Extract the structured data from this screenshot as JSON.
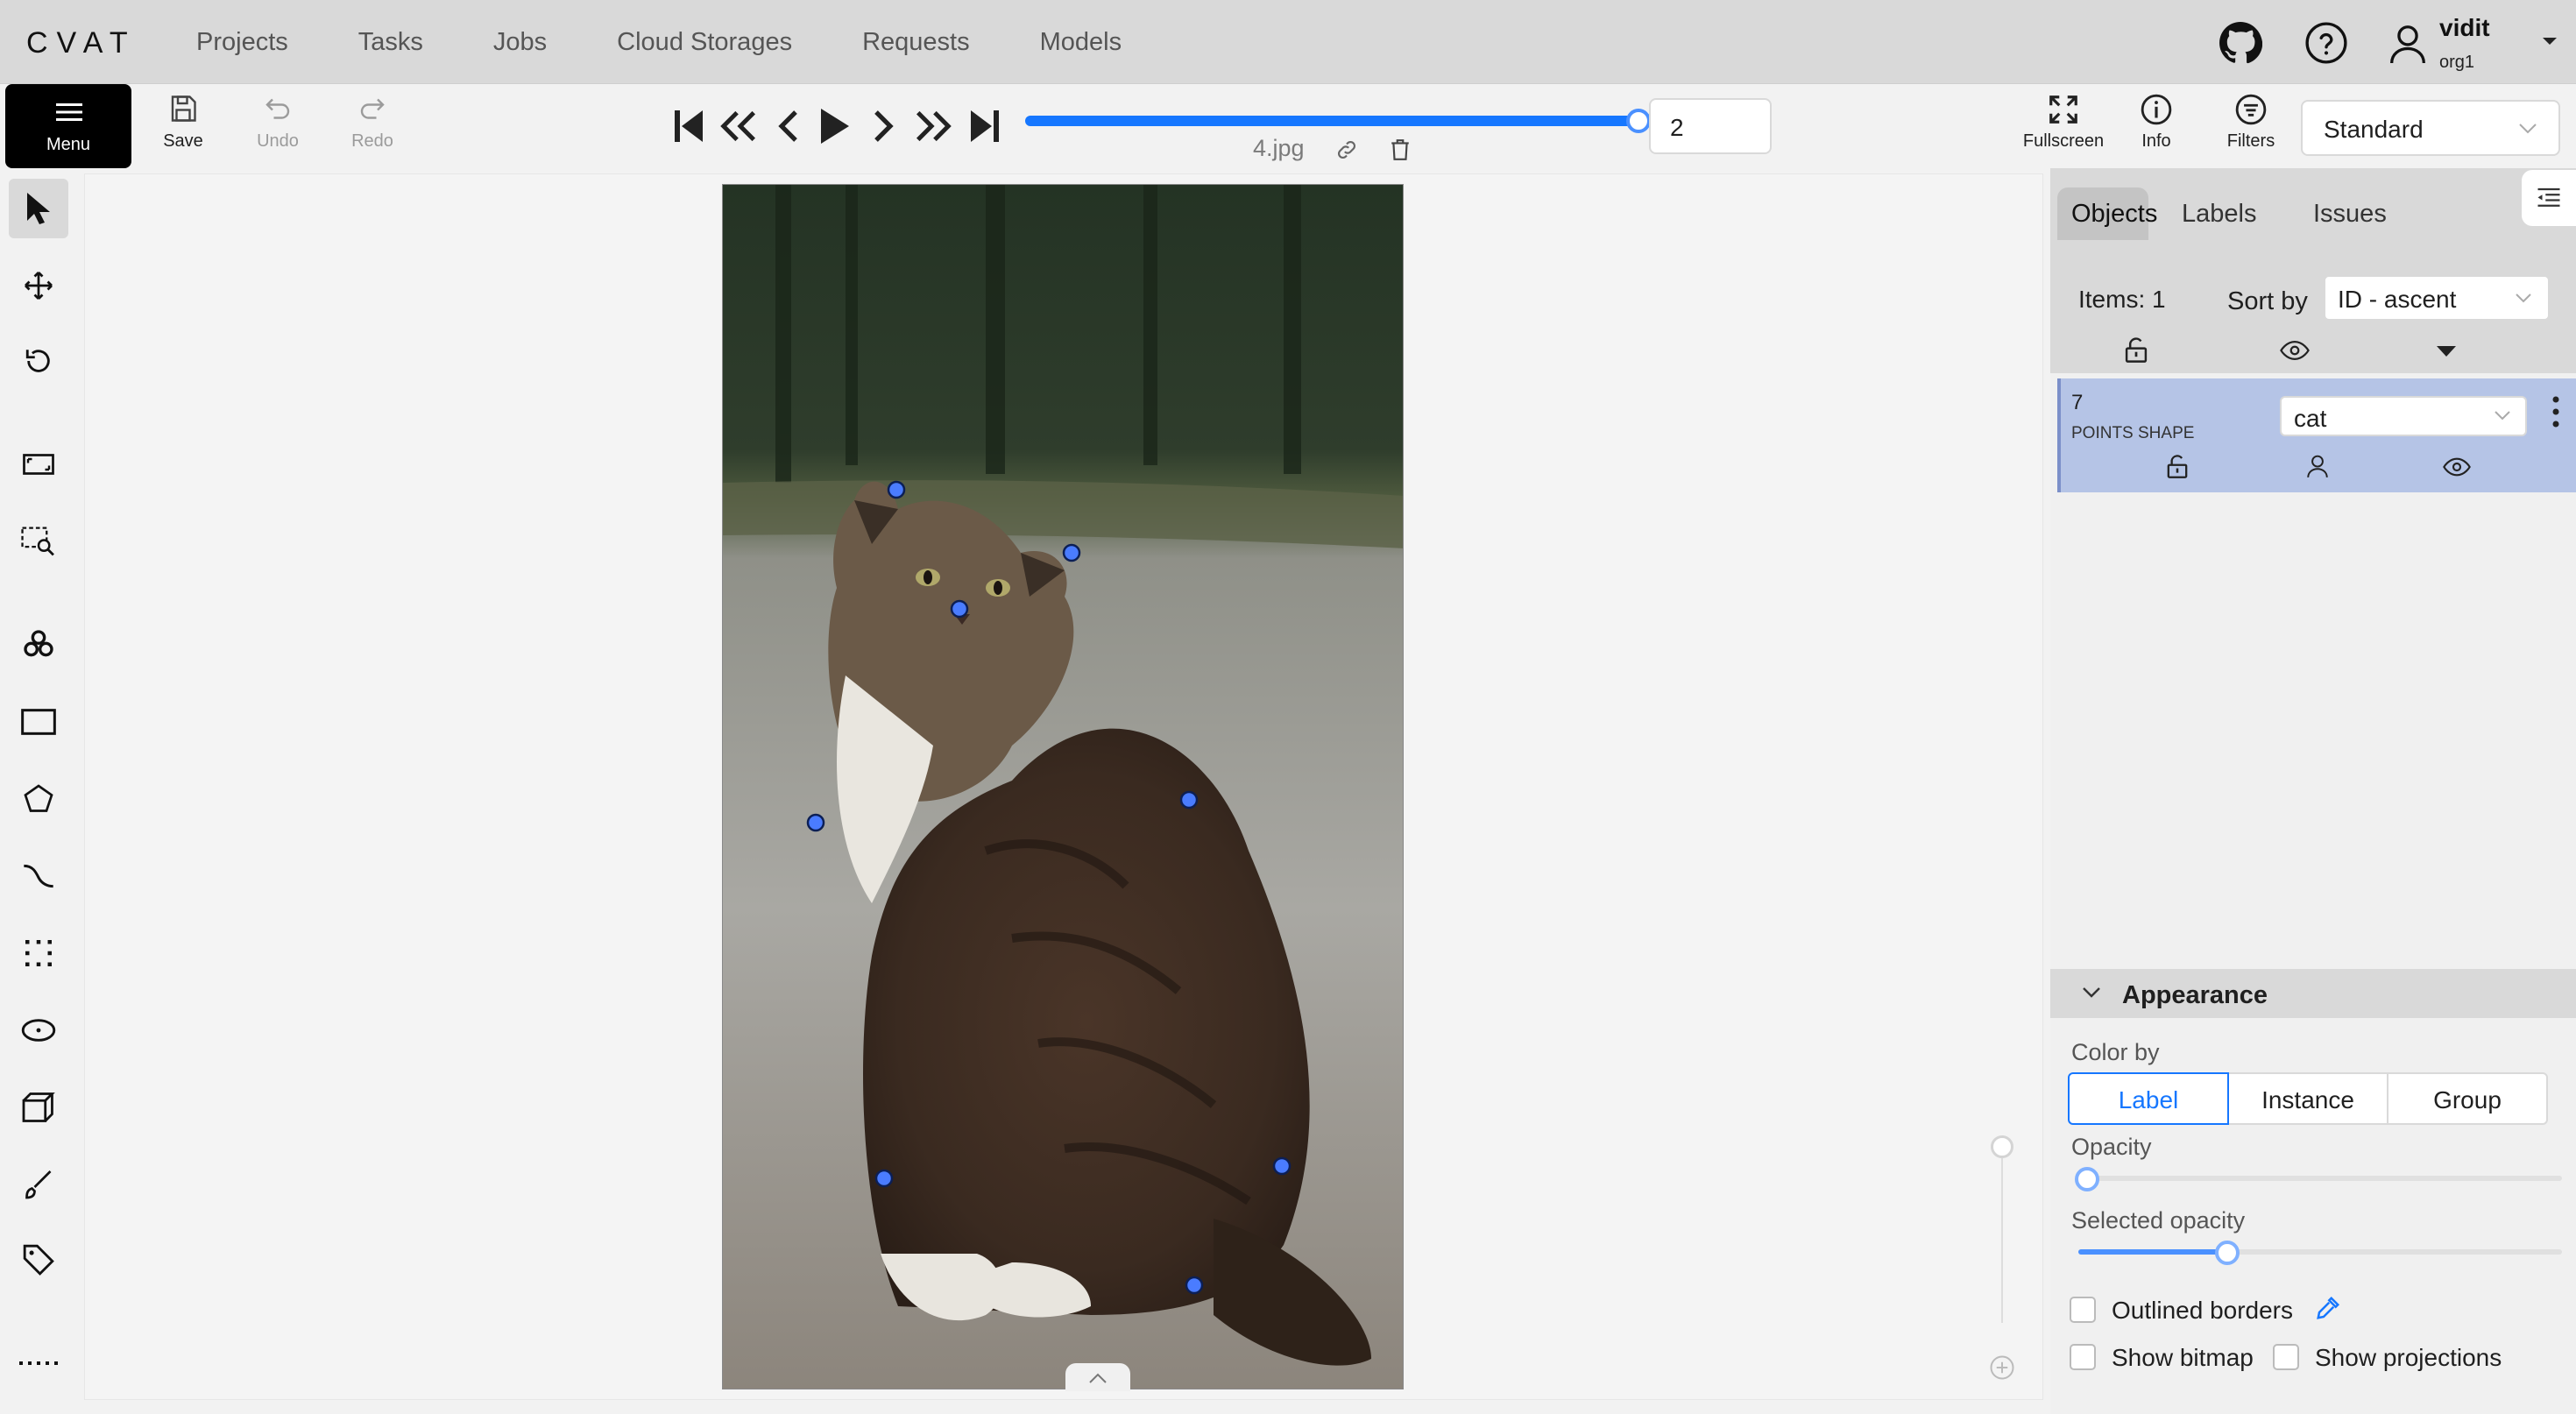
{
  "brand": {
    "logo": "CVAT"
  },
  "nav": {
    "items": [
      "Projects",
      "Tasks",
      "Jobs",
      "Cloud Storages",
      "Requests",
      "Models"
    ]
  },
  "user": {
    "name": "vidit",
    "org": "org1"
  },
  "toolbar": {
    "menu_label": "Menu",
    "save_label": "Save",
    "undo_label": "Undo",
    "redo_label": "Redo",
    "frame_number": "2",
    "filename": "4.jpg",
    "fullscreen_label": "Fullscreen",
    "info_label": "Info",
    "filters_label": "Filters",
    "workspace": "Standard"
  },
  "player": {
    "progress_fraction": 1.0
  },
  "right_panel": {
    "tabs": [
      "Objects",
      "Labels",
      "Issues"
    ],
    "active_tab": "Objects",
    "items_count": "Items: 1",
    "sort_by_label": "Sort by",
    "sort_value": "ID - ascent",
    "object": {
      "id": "7",
      "type": "POINTS SHAPE",
      "label": "cat",
      "color": "#b5c4e6"
    }
  },
  "appearance": {
    "title": "Appearance",
    "color_by_label": "Color by",
    "color_by_options": [
      "Label",
      "Instance",
      "Group"
    ],
    "color_by_selected": "Label",
    "opacity_label": "Opacity",
    "opacity_value": 0.0,
    "selected_opacity_label": "Selected opacity",
    "selected_opacity_value": 0.3,
    "outlined_borders_label": "Outlined borders",
    "show_bitmap_label": "Show bitmap",
    "show_projections_label": "Show projections"
  },
  "colors": {
    "accent": "#1677ff",
    "point_fill": "#4a7cff",
    "object_row": "#b5c4e6"
  },
  "icons": [
    "github-icon",
    "help-icon",
    "user-icon",
    "save-icon",
    "undo-icon",
    "redo-icon",
    "first-frame-icon",
    "fast-backward-icon",
    "prev-frame-icon",
    "play-icon",
    "next-frame-icon",
    "fast-forward-icon",
    "last-frame-icon",
    "link-icon",
    "delete-icon",
    "fullscreen-icon",
    "info-icon",
    "filter-icon"
  ]
}
